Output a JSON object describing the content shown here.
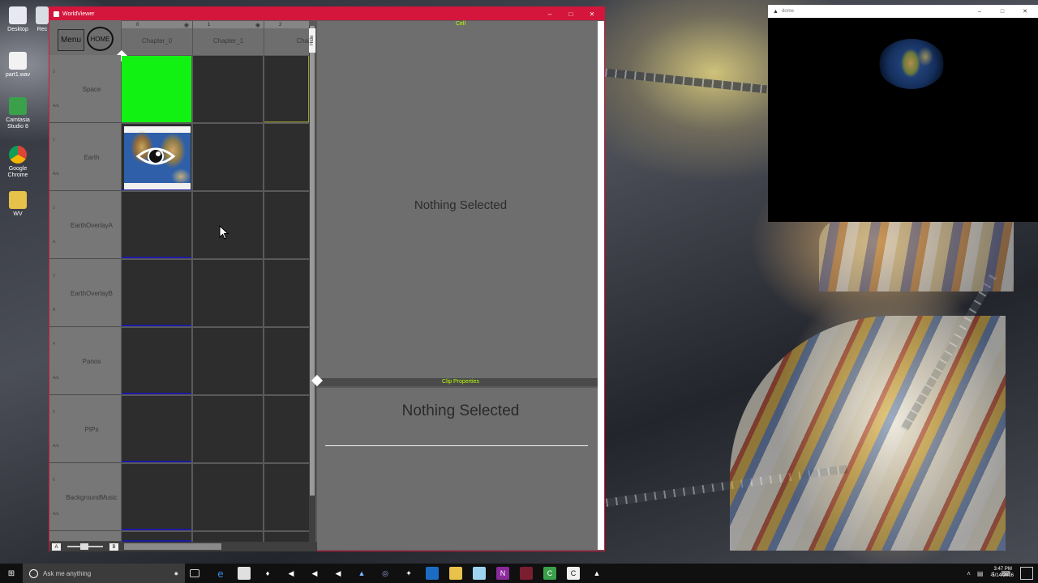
{
  "desktop": {
    "icons": [
      {
        "label": "Desktop",
        "icon": "folder-icon"
      },
      {
        "label": "part1.wav",
        "icon": "audio-file-icon"
      },
      {
        "label": "Camtasia Studio 8",
        "icon": "camtasia-icon"
      },
      {
        "label": "Google Chrome",
        "icon": "chrome-icon"
      },
      {
        "label": "WV",
        "icon": "folder-icon"
      }
    ],
    "partial_icon_label": "Rec"
  },
  "worldviewer": {
    "title": "WorldViewer",
    "menu_label": "Menu",
    "home_label": "HOME",
    "hide_label": "Hide",
    "columns": [
      {
        "index": "0",
        "title": "Chapter_0"
      },
      {
        "index": "1",
        "title": "Chapter_1"
      },
      {
        "index": "2",
        "title": "Chapter_"
      }
    ],
    "rows": [
      {
        "index": "0",
        "name": "Space",
        "a": "A/a"
      },
      {
        "index": "1",
        "name": "Earth",
        "a": "A/a"
      },
      {
        "index": "2",
        "name": "EarthOverlayA",
        "a": "A"
      },
      {
        "index": "3",
        "name": "EarthOverlayB",
        "a": "B"
      },
      {
        "index": "4",
        "name": "Panos",
        "a": "A/a"
      },
      {
        "index": "5",
        "name": "PIPs",
        "a": "A/a"
      },
      {
        "index": "6",
        "name": "BackgroundMusic",
        "a": "A/a"
      }
    ],
    "cell_panel": {
      "tab": "Cell",
      "message": "Nothing Selected"
    },
    "clip_panel": {
      "tab": "Clip Properties",
      "message": "Nothing Selected"
    },
    "bottom": {
      "a_label": "A",
      "b_label": "B"
    },
    "colors": {
      "title_bar": "#d4163c",
      "selected_cell": "#12f212",
      "tab_text": "#b8ff00"
    }
  },
  "globe_window": {
    "title": "dome"
  },
  "taskbar": {
    "search_placeholder": "Ask me anything",
    "time": "3:47 PM",
    "date": "5/14/2016"
  }
}
